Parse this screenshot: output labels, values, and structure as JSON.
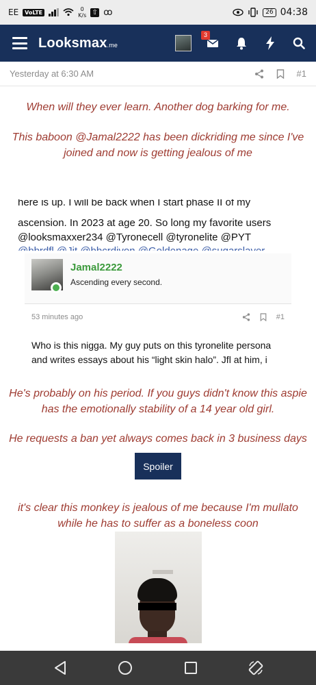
{
  "status_bar": {
    "carrier": "EE",
    "volte": "VoLTE",
    "speed_value": "0",
    "speed_unit": "K/s",
    "battery": "26",
    "time": "04:38",
    "icons": [
      "signal-icon",
      "wifi-icon",
      "download-icon",
      "voicemail-icon",
      "eye-icon",
      "vibrate-icon",
      "battery-icon"
    ]
  },
  "navbar": {
    "logo_main": "Lᴏᴏksmax",
    "logo_suffix": ".me",
    "inbox_count": "3",
    "icons": [
      "menu-icon",
      "avatar",
      "inbox-icon",
      "bell-icon",
      "bolt-icon",
      "search-icon"
    ]
  },
  "post": {
    "timestamp": "Yesterday at 6:30 AM",
    "number": "#1",
    "line1": "When will they ever learn. Another dog barking for me.",
    "line2": "This baboon @Jamal2222 has been dickriding me since I've joined and now is getting jealous of me"
  },
  "quoted": {
    "text_top": "here is up. I will be back when I start phase II of my",
    "text_main": "ascension. In 2023 at age 20. So long my favorite users @looksmaxxer234 @Tyronecell @tyronelite @PYT",
    "text_cut": "@bbrdfl     @Jit     @bbcrdjvon     @Goldenage     @sugarslaver",
    "user": "Jamal2222",
    "user_title": "Ascending every second.",
    "time": "53 minutes ago",
    "number": "#1",
    "body": "Who is this nigga. My guy puts on this tyronelite persona and writes essays about his “light skin halo”. Jfl at him, i"
  },
  "reply": {
    "line3": "He's probably on his period. If you guys didn't know this aspie has the emotionally stability of a 14 year old girl.",
    "line4": "He requests a ban yet always comes back in 3 business days",
    "spoiler_label": "Spoiler",
    "line5": "it's clear this monkey is jealous of me because I'm mullato while he has to suffer as a boneless coon"
  },
  "colors": {
    "navbar": "#18305a",
    "accent_text": "#9e3b31",
    "username": "#3c9a3c",
    "badge": "#e03a2f"
  }
}
